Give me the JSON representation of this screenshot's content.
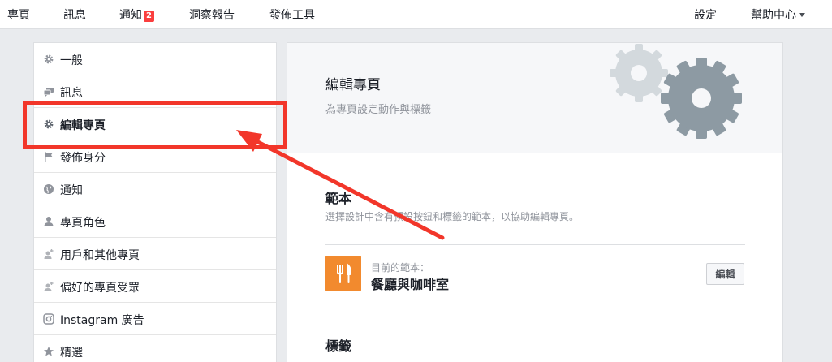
{
  "topnav": {
    "items": [
      {
        "label": "專頁"
      },
      {
        "label": "訊息"
      },
      {
        "label": "通知",
        "badge": "2"
      },
      {
        "label": "洞察報告"
      },
      {
        "label": "發佈工具"
      }
    ],
    "settings": "設定",
    "help": "幫助中心"
  },
  "sidebar": {
    "items": [
      {
        "label": "一般",
        "icon": "gear-icon"
      },
      {
        "label": "訊息",
        "icon": "chat-bubbles-icon"
      },
      {
        "label": "編輯專頁",
        "icon": "gear-icon",
        "active": true
      },
      {
        "label": "發佈身分",
        "icon": "flag-icon"
      },
      {
        "label": "通知",
        "icon": "globe-icon"
      },
      {
        "label": "專頁角色",
        "icon": "person-icon"
      },
      {
        "label": "用戶和其他專頁",
        "icon": "person-plus-icon"
      },
      {
        "label": "偏好的專頁受眾",
        "icon": "person-plus-icon"
      },
      {
        "label": "Instagram 廣告",
        "icon": "instagram-icon"
      },
      {
        "label": "精選",
        "icon": "star-icon"
      }
    ]
  },
  "main": {
    "title": "編輯專頁",
    "subtitle": "為專頁設定動作與標籤",
    "templates": {
      "title": "範本",
      "description": "選擇設計中含有預設按鈕和標籤的範本，以協助編輯專頁。",
      "current_caption": "目前的範本：",
      "current_name": "餐廳與咖啡室",
      "edit_button": "編輯"
    },
    "tabs_section": {
      "title": "標籤"
    }
  },
  "colors": {
    "highlight": "#f2362a",
    "template_icon": "#f28a2e",
    "badge": "#fa3e3e",
    "gear_dark": "#8d9aa3",
    "gear_light": "#d3d9dd"
  }
}
